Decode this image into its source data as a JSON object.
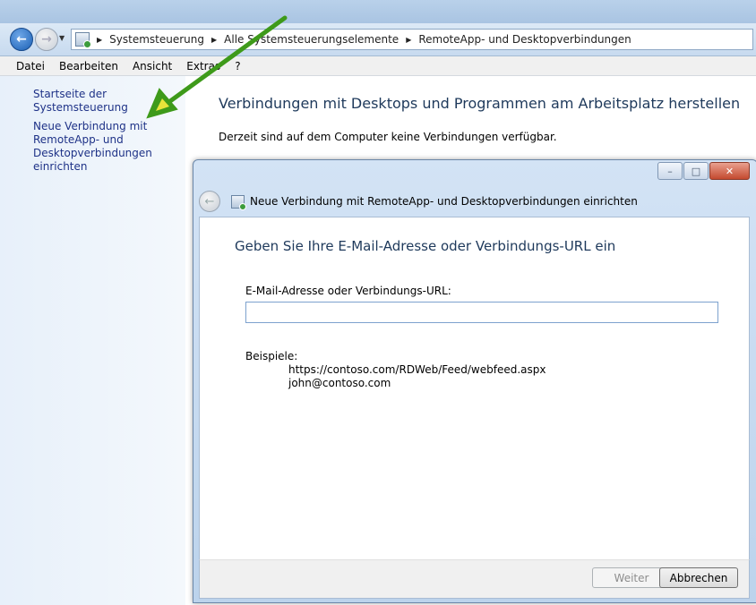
{
  "address_bar": {
    "breadcrumbs": [
      "Systemsteuerung",
      "Alle Systemsteuerungselemente",
      "RemoteApp- und Desktopverbindungen"
    ]
  },
  "menu": [
    "Datei",
    "Bearbeiten",
    "Ansicht",
    "Extras",
    "?"
  ],
  "left_pane": {
    "home_link": "Startseite der Systemsteuerung",
    "new_connection_lines": [
      "Neue Verbindung mit",
      "RemoteApp- und",
      "Desktopverbindungen",
      "einrichten"
    ]
  },
  "main": {
    "title": "Verbindungen mit Desktops und Programmen am Arbeitsplatz herstellen",
    "description": "Derzeit sind auf dem Computer keine Verbindungen verfügbar."
  },
  "dialog": {
    "title": "Neue Verbindung mit RemoteApp- und Desktopverbindungen einrichten",
    "heading": "Geben Sie Ihre E-Mail-Adresse oder Verbindungs-URL ein",
    "field_label": "E-Mail-Adresse oder Verbindungs-URL:",
    "field_value": "",
    "examples_label": "Beispiele:",
    "example_url": "https://contoso.com/RDWeb/Feed/webfeed.aspx",
    "example_email": "john@contoso.com",
    "next_button": "Weiter",
    "cancel_button": "Abbrechen"
  },
  "colors": {
    "link": "#1e3287",
    "heading": "#1e395b",
    "annotation_arrow": "#3e9a1a"
  },
  "icons": [
    "back-arrow-icon",
    "forward-arrow-icon",
    "control-panel-icon",
    "remoteapp-icon",
    "minimize-icon",
    "maximize-icon",
    "close-icon"
  ]
}
